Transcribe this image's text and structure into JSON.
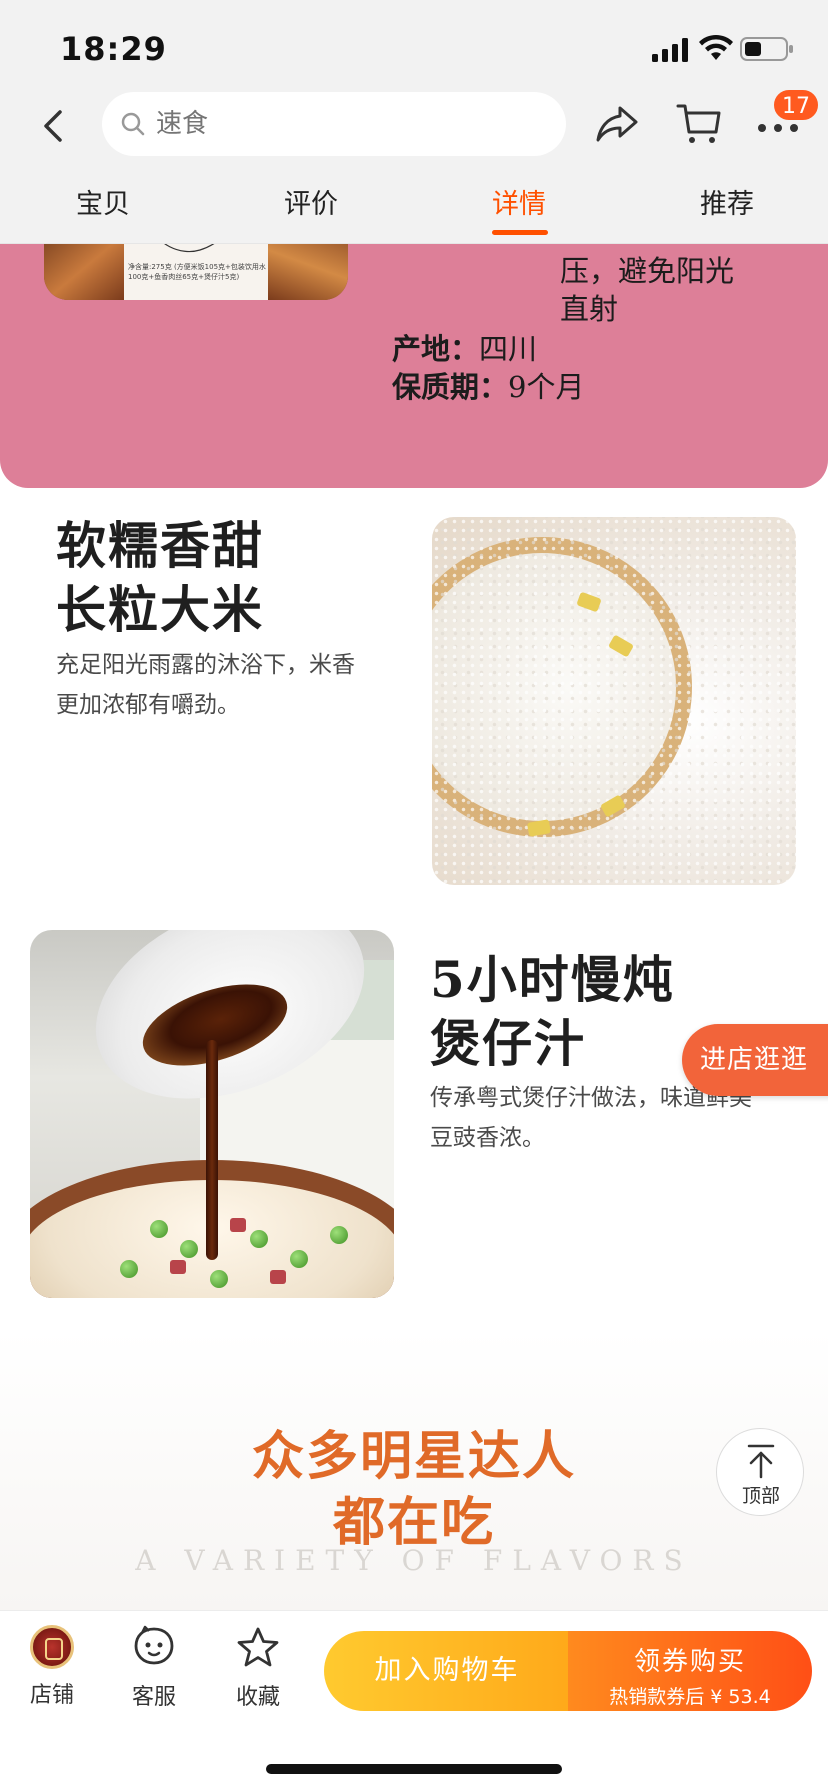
{
  "status_bar": {
    "time": "18:29"
  },
  "header": {
    "search_placeholder": "速食",
    "cart_badge": "17",
    "icons": [
      "back-icon",
      "search-icon",
      "share-icon",
      "cart-icon",
      "more-icon"
    ]
  },
  "tabs": [
    {
      "label": "宝贝",
      "active": false
    },
    {
      "label": "评价",
      "active": false
    },
    {
      "label": "详情",
      "active": true
    },
    {
      "label": "推荐",
      "active": false
    }
  ],
  "product_info": {
    "storage_line1": "压，避免阳光",
    "storage_line2": "直射",
    "origin_label": "产地：",
    "origin_value": "四川",
    "shelf_label": "保质期：",
    "shelf_value": "9个月",
    "package_fine_print": "净含量:275克 (方便米饭105克+包装饮用水100克+鱼香肉丝65克+煲仔汁5克)"
  },
  "features": [
    {
      "title_line1": "软糯香甜",
      "title_line2": "长粒大米",
      "desc_line1": "充足阳光雨露的沐浴下，米香",
      "desc_line2": "更加浓郁有嚼劲。"
    },
    {
      "title_line1": "5小时慢炖",
      "title_line2": "煲仔汁",
      "desc_line1": "传承粤式煲仔汁做法，味道鲜美",
      "desc_line2": "豆豉香浓。"
    }
  ],
  "floating": {
    "visit_store": "进店逛逛",
    "top_label": "顶部"
  },
  "promo": {
    "line1": "众多明星达人",
    "line2": "都在吃",
    "english": "A VARIETY OF FLAVORS"
  },
  "bottom_bar": {
    "shop": "店铺",
    "service": "客服",
    "favorite": "收藏",
    "add_to_cart": "加入购物车",
    "buy_main": "领券购买",
    "buy_sub": "热销款券后 ¥ 53.4"
  },
  "colors": {
    "accent": "#ff5000",
    "pink_bg": "#dd7f98",
    "promo_orange": "#e06a28",
    "cart_yellow": "#ffb21e",
    "buy_orange": "#ff5f16"
  }
}
